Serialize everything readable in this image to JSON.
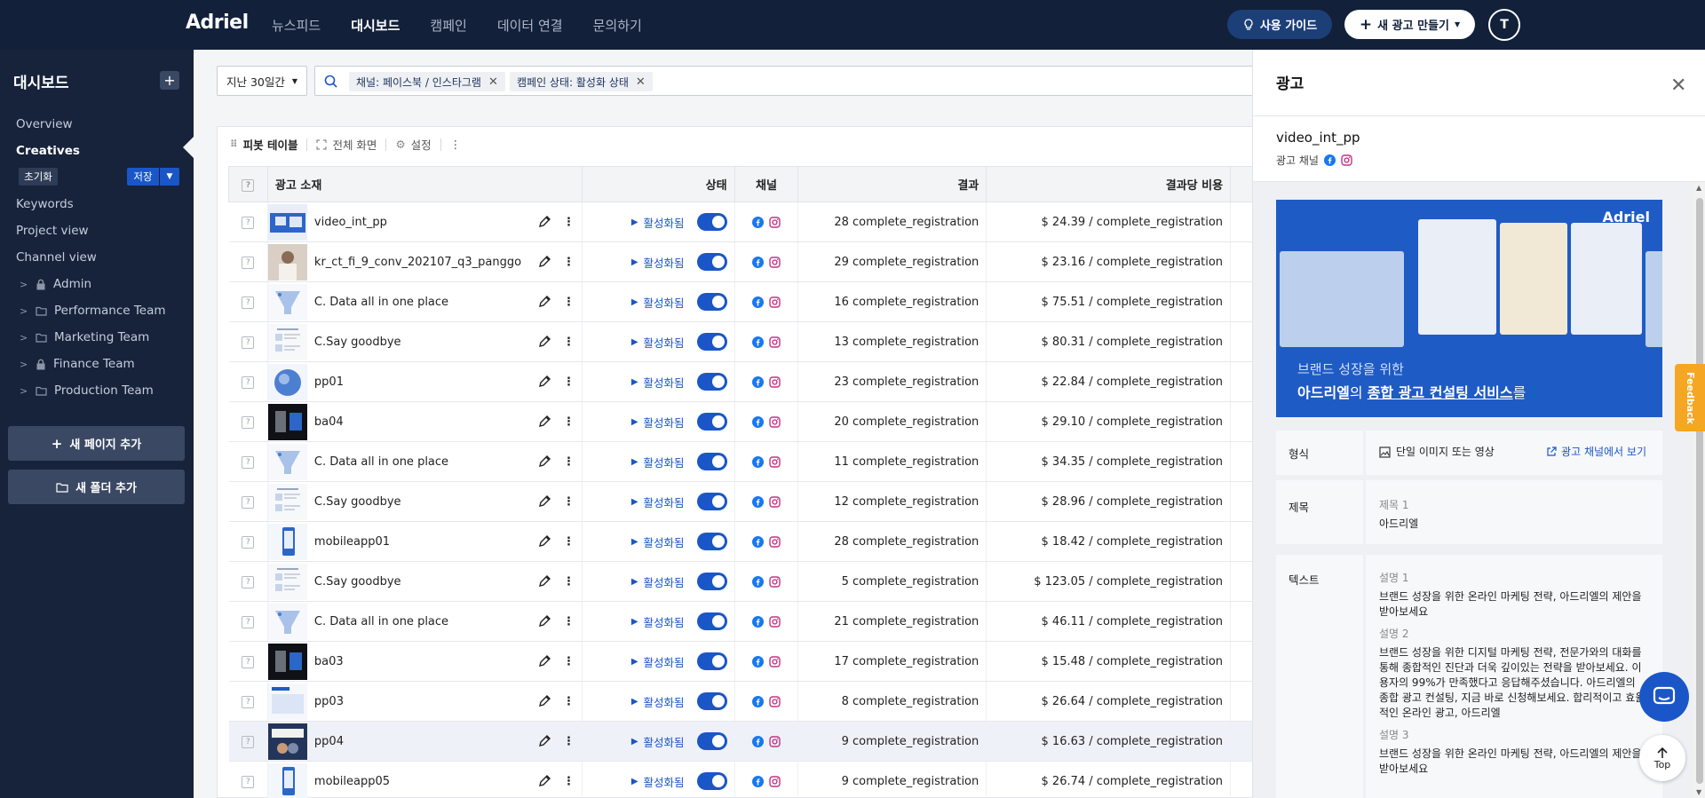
{
  "topnav": {
    "logo": "Adriel",
    "links": [
      "뉴스피드",
      "대시보드",
      "캠페인",
      "데이터 연결",
      "문의하기"
    ],
    "active_index": 1,
    "guide_label": "사용 가이드",
    "new_ad_label": "새 광고 만들기",
    "avatar_initial": "T"
  },
  "sidebar": {
    "title": "대시보드",
    "items": [
      "Overview",
      "Creatives",
      "Keywords",
      "Project view",
      "Channel view"
    ],
    "active_index": 1,
    "reset_label": "초기화",
    "save_label": "저장",
    "folders": [
      {
        "name": "Admin",
        "icon": "lock-icon"
      },
      {
        "name": "Performance Team",
        "icon": "folder-icon"
      },
      {
        "name": "Marketing Team",
        "icon": "folder-icon"
      },
      {
        "name": "Finance Team",
        "icon": "lock-icon"
      },
      {
        "name": "Production Team",
        "icon": "folder-icon"
      }
    ],
    "add_page_label": "새 페이지 추가",
    "add_folder_label": "새 폴더 추가"
  },
  "filters": {
    "period": "지난 30일간",
    "chips": [
      "채널: 페이스북 / 인스타그램",
      "캠페인 상태: 활성화 상태"
    ]
  },
  "toolbar": {
    "pivot": "피봇 테이블",
    "fullscreen": "전체 화면",
    "settings": "설정"
  },
  "table": {
    "headers": {
      "creative": "광고 소재",
      "status": "상태",
      "channel": "채널",
      "result": "결과",
      "cost": "결과당 비용"
    },
    "status_label": "활성화됨",
    "rows": [
      {
        "name": "video_int_pp",
        "result": "28 complete_registration",
        "cost": "$ 24.39 / complete_registration",
        "thumb": "blue"
      },
      {
        "name": "kr_ct_fi_9_conv_202107_q3_panggo",
        "result": "29 complete_registration",
        "cost": "$ 23.16 / complete_registration",
        "thumb": "photo"
      },
      {
        "name": "C. Data all in one place",
        "result": "16 complete_registration",
        "cost": "$ 75.51 / complete_registration",
        "thumb": "funnel"
      },
      {
        "name": "C.Say goodbye",
        "result": "13 complete_registration",
        "cost": "$ 80.31 / complete_registration",
        "thumb": "doc"
      },
      {
        "name": "pp01",
        "result": "23 complete_registration",
        "cost": "$ 22.84 / complete_registration",
        "thumb": "circle"
      },
      {
        "name": "ba04",
        "result": "20 complete_registration",
        "cost": "$ 29.10 / complete_registration",
        "thumb": "dark"
      },
      {
        "name": "C. Data all in one place",
        "result": "11 complete_registration",
        "cost": "$ 34.35 / complete_registration",
        "thumb": "funnel"
      },
      {
        "name": "C.Say goodbye",
        "result": "12 complete_registration",
        "cost": "$ 28.96 / complete_registration",
        "thumb": "doc"
      },
      {
        "name": "mobileapp01",
        "result": "28 complete_registration",
        "cost": "$ 18.42 / complete_registration",
        "thumb": "mobile"
      },
      {
        "name": "C.Say goodbye",
        "result": "5 complete_registration",
        "cost": "$ 123.05 / complete_registration",
        "thumb": "doc"
      },
      {
        "name": "C. Data all in one place",
        "result": "21 complete_registration",
        "cost": "$ 46.11 / complete_registration",
        "thumb": "funnel"
      },
      {
        "name": "ba03",
        "result": "17 complete_registration",
        "cost": "$ 15.48 / complete_registration",
        "thumb": "dark"
      },
      {
        "name": "pp03",
        "result": "8 complete_registration",
        "cost": "$ 26.64 / complete_registration",
        "thumb": "adriel"
      },
      {
        "name": "pp04",
        "result": "9 complete_registration",
        "cost": "$ 16.63 / complete_registration",
        "thumb": "photo2"
      },
      {
        "name": "mobileapp05",
        "result": "9 complete_registration",
        "cost": "$ 26.74 / complete_registration",
        "thumb": "mobile"
      }
    ],
    "highlight_index": 13
  },
  "drawer": {
    "title": "광고",
    "ad_name": "video_int_pp",
    "channel_label": "광고 채널",
    "banner": {
      "logo": "Adriel",
      "line1": "브랜드 성장을 위한",
      "line2_pre": "아드리엘",
      "line2_mid": "의 ",
      "line2_u": "종합 광고 컨설팅 서비스",
      "line2_post": "를"
    },
    "format_label": "형식",
    "format_value": "단일 이미지 또는 영상",
    "view_link": "광고 채널에서 보기",
    "title_label": "제목",
    "title_sub": "제목 1",
    "title_value": "아드리엘",
    "text_label": "텍스트",
    "texts": [
      {
        "sub": "설명 1",
        "value": "브랜드 성장을 위한 온라인 마케팅 전략, 아드리엘의 제안을 받아보세요"
      },
      {
        "sub": "설명 2",
        "value": "브랜드 성장을 위한 디지털 마케팅 전략, 전문가와의 대화를 통해 종합적인 진단과 더욱 깊이있는 전략을 받아보세요. 이용자의 99%가 만족했다고 응답해주셨습니다. 아드리엘의 종합 광고 컨설팅, 지금 바로 신청해보세요. 합리적이고 효율적인 온라인 광고, 아드리엘"
      },
      {
        "sub": "설명 3",
        "value": "브랜드 성장을 위한 온라인 마케팅 전략, 아드리엘의 제안을 받아보세요"
      }
    ]
  },
  "feedback_label": "Feedback",
  "top_label": "Top",
  "colors": {
    "nav": "#12203a",
    "sidebar": "#16233b",
    "accent": "#1a56c7",
    "facebook": "#1877f2",
    "instagram": "#c13584",
    "feedback": "#f5a623"
  }
}
